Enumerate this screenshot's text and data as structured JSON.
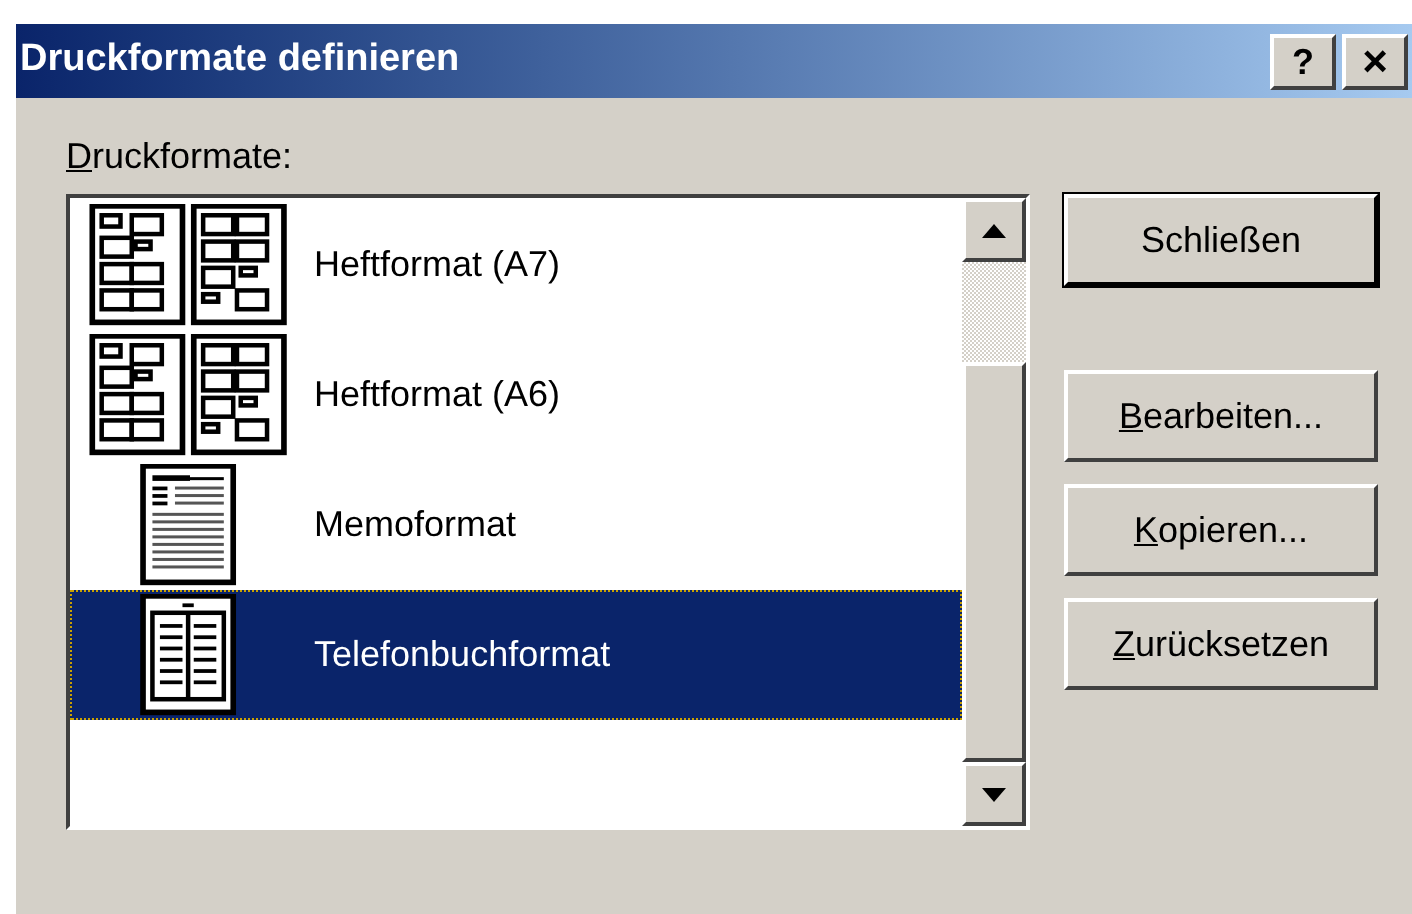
{
  "window": {
    "title": "Druckformate definieren",
    "help_button": "?",
    "close_button": "×"
  },
  "list_label": {
    "text": "Druckformate:",
    "underlined_first": true
  },
  "formats": [
    {
      "label": "Heftformat (A7)",
      "kind": "booklet",
      "selected": false
    },
    {
      "label": "Heftformat (A6)",
      "kind": "booklet",
      "selected": false
    },
    {
      "label": "Memoformat",
      "kind": "memo",
      "selected": false
    },
    {
      "label": "Telefonbuchformat",
      "kind": "phonebook",
      "selected": true
    }
  ],
  "buttons": [
    {
      "label": "Schließen",
      "underlined_first": false,
      "default": true
    },
    {
      "label": "Bearbeiten...",
      "underlined_first": true,
      "default": false
    },
    {
      "label": "Kopieren...",
      "underlined_first": true,
      "default": false
    },
    {
      "label": "Zurücksetzen",
      "underlined_first": true,
      "default": false
    }
  ]
}
